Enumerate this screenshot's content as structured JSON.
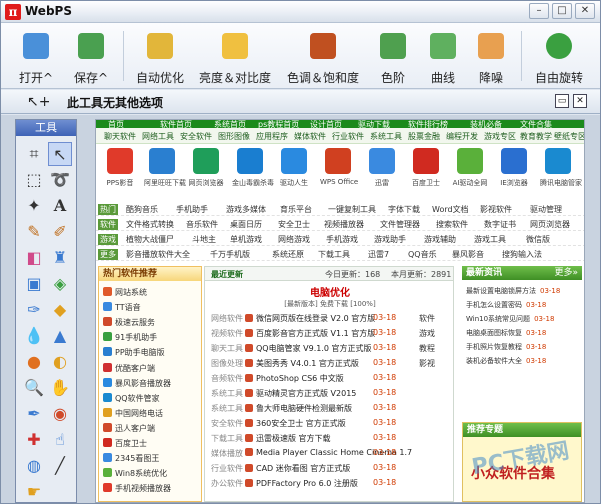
{
  "app": {
    "title": "WebPS",
    "logo": "π"
  },
  "window": {
    "minimize": "–",
    "maximize": "□",
    "close": "✕"
  },
  "toolbar": {
    "buttons": [
      {
        "label": "打开^",
        "icon": "folder-open-icon",
        "color": "#4a90d9"
      },
      {
        "label": "保存^",
        "icon": "save-icon",
        "color": "#4aa050"
      },
      {
        "label": "自动优化",
        "icon": "auto-enhance-icon",
        "color": "#e2b63a"
      },
      {
        "label": "亮度＆对比度",
        "icon": "sun-contrast-icon",
        "color": "#f0c040"
      },
      {
        "label": "色调＆饱和度",
        "icon": "hue-saturation-icon",
        "color": "#c05020"
      },
      {
        "label": "色阶",
        "icon": "levels-icon",
        "color": "#4fa04f"
      },
      {
        "label": "曲线",
        "icon": "curves-icon",
        "color": "#5fb05f"
      },
      {
        "label": "降噪",
        "icon": "denoise-icon",
        "color": "#e8a050"
      },
      {
        "label": "自由旋转",
        "icon": "rotate-icon",
        "color": "#3aa040"
      }
    ]
  },
  "options": {
    "label": "此工具无其他选项"
  },
  "toolpanel": {
    "title": "工具"
  },
  "page": {
    "nav": [
      "首页",
      "软件首页",
      "系统首页",
      "ps教程首页",
      "设计首页",
      "驱动下载",
      "软件排行榜",
      "装机必备",
      "文件合集"
    ],
    "subnav": [
      "聊天软件",
      "网络工具",
      "安全软件",
      "图形图像",
      "应用程序",
      "媒体软件",
      "行业软件",
      "系统工具",
      "股票金融",
      "编程开发",
      "游戏专区",
      "教育教学",
      "壁纸专区"
    ],
    "apps": [
      {
        "name": "PPS影音",
        "color": "#e03a2a"
      },
      {
        "name": "阿里旺旺下载",
        "color": "#2a7fd0"
      },
      {
        "name": "网页浏览器",
        "color": "#1f9e5a"
      },
      {
        "name": "金山毒霸杀毒",
        "color": "#1a7ed0"
      },
      {
        "name": "驱动人生",
        "color": "#2a8ae0"
      },
      {
        "name": "WPS Office",
        "color": "#d04020"
      },
      {
        "name": "迅雷",
        "color": "#3a8ae0"
      },
      {
        "name": "百度卫士",
        "color": "#d02a20"
      },
      {
        "name": "AI驱动全网",
        "color": "#5ab03a"
      },
      {
        "name": "IE浏览器",
        "color": "#2a6fd0"
      },
      {
        "name": "腾讯电脑管家",
        "color": "#1a8ad0"
      }
    ],
    "catrows": [
      {
        "head": "热门",
        "items": [
          "酷狗音乐",
          "手机助手",
          "游戏多媒体",
          "育乐平台",
          "一键复制工具",
          "字体下载",
          "Word文档",
          "影视软件",
          "驱动管理"
        ]
      },
      {
        "head": "软件",
        "items": [
          "文件格式转换",
          "音乐软件",
          "桌面日历",
          "安全卫士",
          "视频播放器",
          "文件管理器",
          "搜索软件",
          "数字证书",
          "网页浏览器"
        ]
      },
      {
        "head": "游戏",
        "items": [
          "植物大战僵尸",
          "斗地主",
          "单机游戏",
          "网络游戏",
          "手机游戏",
          "游戏助手",
          "游戏辅助",
          "游戏工具",
          "微信版"
        ]
      },
      {
        "head": "更多",
        "items": [
          "影音播放软件大全",
          "千万手机版",
          "系统还原",
          "下载工具",
          "迅雷7",
          "QQ音乐",
          "暴风影音",
          "搜狗输入法"
        ]
      }
    ],
    "left": {
      "title": "热门软件推荐",
      "items": [
        {
          "text": "网站系统",
          "color": "#e05a2a"
        },
        {
          "text": "TT语音",
          "color": "#3a8ae0"
        },
        {
          "text": "极速云服务",
          "color": "#d04a2a"
        },
        {
          "text": "91手机助手",
          "color": "#3aa040"
        },
        {
          "text": "PP助手电脑版",
          "color": "#2a7fd0"
        },
        {
          "text": "优酷客户端",
          "color": "#d03030"
        },
        {
          "text": "暴风影音播放器",
          "color": "#2a8ae0"
        },
        {
          "text": "QQ软件管家",
          "color": "#1a8ad0"
        },
        {
          "text": "中国网络电话",
          "color": "#e0a020"
        },
        {
          "text": "迅人客户端",
          "color": "#d04a2a"
        },
        {
          "text": "百度卫士",
          "color": "#d02a20"
        },
        {
          "text": "2345看图王",
          "color": "#3a8ae0"
        },
        {
          "text": "Win8系统优化",
          "color": "#5ab03a"
        },
        {
          "text": "手机视频播放器",
          "color": "#e03a2a"
        }
      ]
    },
    "middle": {
      "tabs": [
        "最近更新",
        "今日更新：168",
        "本月更新：2891"
      ],
      "promo_title": "电脑优化",
      "promo_sub": "[最新版本] 免费下载 [100%]",
      "rows": [
        {
          "cat": "网络软件",
          "title": "微信网页版在线登录 V2.0 官方版",
          "date": "03-18",
          "side": "软件"
        },
        {
          "cat": "视频软件",
          "title": "百度影音官方正式版 V1.1 官方版",
          "date": "03-18",
          "side": "游戏"
        },
        {
          "cat": "聊天工具",
          "title": "QQ电脑管家 V9.1.0 官方正式版",
          "date": "03-18",
          "side": "教程"
        },
        {
          "cat": "图像处理",
          "title": "美图秀秀 V4.0.1 官方正式版",
          "date": "03-18",
          "side": "影视"
        },
        {
          "cat": "音频软件",
          "title": "PhotoShop CS6 中文版",
          "date": "03-18",
          "side": ""
        },
        {
          "cat": "系统工具",
          "title": "驱动精灵官方正式版 V2015",
          "date": "03-18",
          "side": ""
        },
        {
          "cat": "系统工具",
          "title": "鲁大师电脑硬件检测最新版",
          "date": "03-18",
          "side": ""
        },
        {
          "cat": "安全软件",
          "title": "360安全卫士 官方正式版",
          "date": "03-18",
          "side": ""
        },
        {
          "cat": "下载工具",
          "title": "迅雷极速版 官方下载",
          "date": "03-18",
          "side": ""
        },
        {
          "cat": "媒体播放",
          "title": "Media Player Classic Home Cinema 1.7",
          "date": "03-18",
          "side": ""
        },
        {
          "cat": "行业软件",
          "title": "CAD 迷你看图 官方正式版",
          "date": "03-18",
          "side": ""
        },
        {
          "cat": "办公软件",
          "title": "PDFFactory Pro 6.0 注册版",
          "date": "03-18",
          "side": ""
        }
      ]
    },
    "right": {
      "title": "最新资讯",
      "more": "更多»",
      "items": [
        {
          "text": "最新设置电脑锁屏方法",
          "date": "03-18"
        },
        {
          "text": "手机怎么设置密码",
          "date": "03-18"
        },
        {
          "text": "Win10系统常见问题",
          "date": "03-18"
        },
        {
          "text": "电脑桌面图标恢复",
          "date": "03-18"
        },
        {
          "text": "手机照片恢复教程",
          "date": "03-18"
        },
        {
          "text": "装机必备软件大全",
          "date": "03-18"
        }
      ],
      "banner_title": "推荐专题",
      "banner_text": "小众软件合集"
    }
  },
  "watermark": "PC下载网"
}
